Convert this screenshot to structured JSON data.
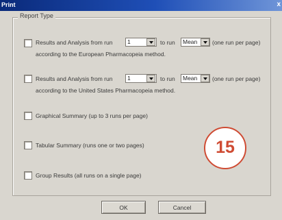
{
  "window": {
    "title": "Print",
    "close_glyph": "x"
  },
  "report_type": {
    "legend": "Report Type",
    "rows": [
      {
        "line1_prefix": "Results and Analysis from run",
        "run_from": "1",
        "to_run": "to run",
        "run_to": "Mean",
        "per_page": "(one run per page)",
        "line2": "according to the European Pharmacopeia method."
      },
      {
        "line1_prefix": "Results and Analysis from run",
        "run_from": "1",
        "to_run": "to run",
        "run_to": "Mean",
        "per_page": "(one run per page)",
        "line2": "according to the United States Pharmacopeia method."
      }
    ],
    "graphical": "Graphical Summary (up to 3 runs per page)",
    "tabular": "Tabular Summary (runs one or two pages)",
    "group": "Group Results (all runs on a single page)"
  },
  "buttons": {
    "ok": "OK",
    "cancel": "Cancel"
  },
  "badge": "15",
  "colors": {
    "titlebar": "#1f4fb7",
    "badge": "#cf4b33",
    "dialog": "#d9d6cf"
  }
}
